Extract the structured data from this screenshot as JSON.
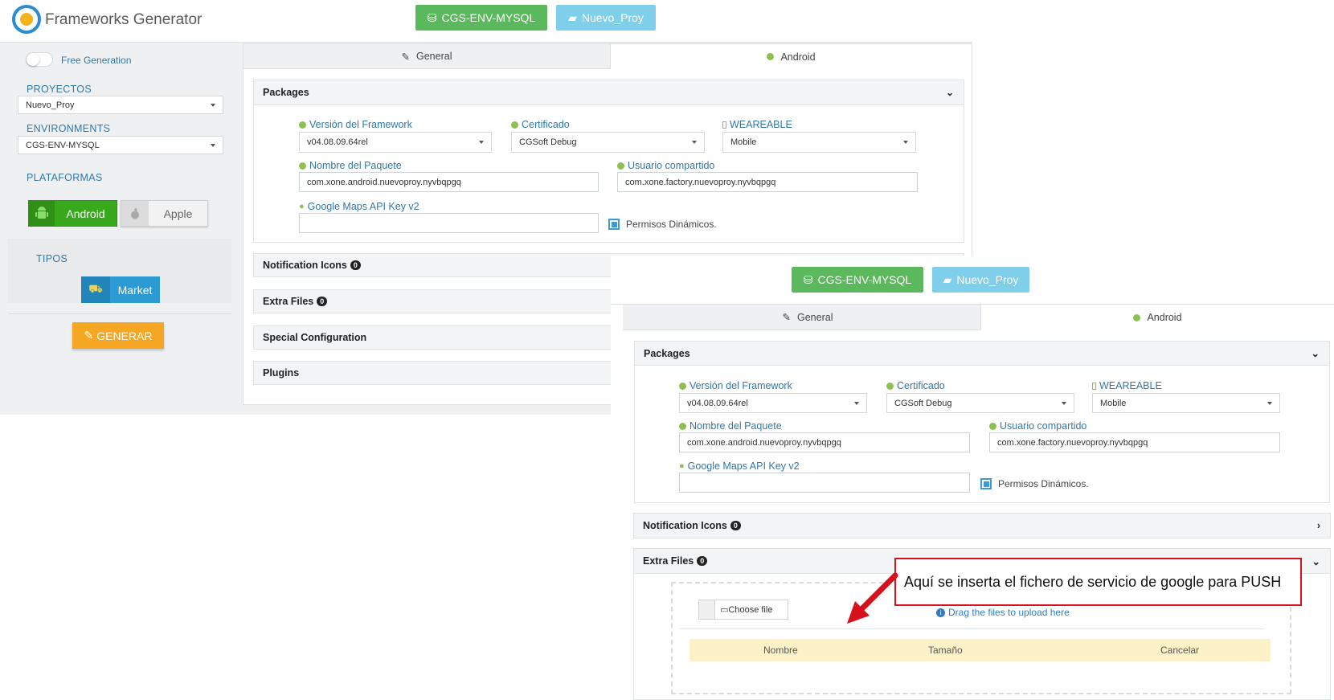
{
  "app": {
    "title": "Frameworks Generator"
  },
  "top_buttons": {
    "environment": "CGS-ENV-MYSQL",
    "project": "Nuevo_Proy"
  },
  "sidebar": {
    "free_generation": "Free Generation",
    "proyectos_label": "PROYECTOS",
    "proyectos_value": "Nuevo_Proy",
    "environments_label": "ENVIRONMENTS",
    "environments_value": "CGS-ENV-MYSQL",
    "plataformas_label": "PLATAFORMAS",
    "platform_android": "Android",
    "platform_apple": "Apple",
    "tipos_label": "TIPOS",
    "market": "Market",
    "generar": "GENERAR"
  },
  "tabs": {
    "general": "General",
    "android": "Android"
  },
  "packages": {
    "title": "Packages",
    "framework_label": "Versión del Framework",
    "framework_value": "v04.08.09.64rel",
    "certificado_label": "Certificado",
    "certificado_value": "CGSoft Debug",
    "wearable_label": "WEAREABLE",
    "wearable_value": "Mobile",
    "paquete_label": "Nombre del Paquete",
    "paquete_value": "com.xone.android.nuevoproy.nyvbqpgq",
    "usuario_label": "Usuario compartido",
    "usuario_value": "com.xone.factory.nuevoproy.nyvbqpgq",
    "maps_label": "Google Maps API Key v2",
    "maps_value": "",
    "permisos_label": "Permisos Dinámicos."
  },
  "sections": {
    "notification_icons": "Notification Icons",
    "notification_count": "0",
    "extra_files": "Extra Files",
    "extra_files_count": "0",
    "special_configuration": "Special Configuration",
    "plugins": "Plugins"
  },
  "upload": {
    "choose_file": "Choose file",
    "drag_hint": "Drag the files to upload here",
    "columns": [
      "Nombre",
      "Tamaño",
      "Cancelar"
    ]
  },
  "annotation": {
    "text": "Aquí se inserta el fichero de servicio de google para PUSH"
  },
  "colors": {
    "green": "#5cb85c",
    "light_blue": "#7fcfea",
    "orange": "#f5a623",
    "annotation_red": "#d7111b"
  }
}
